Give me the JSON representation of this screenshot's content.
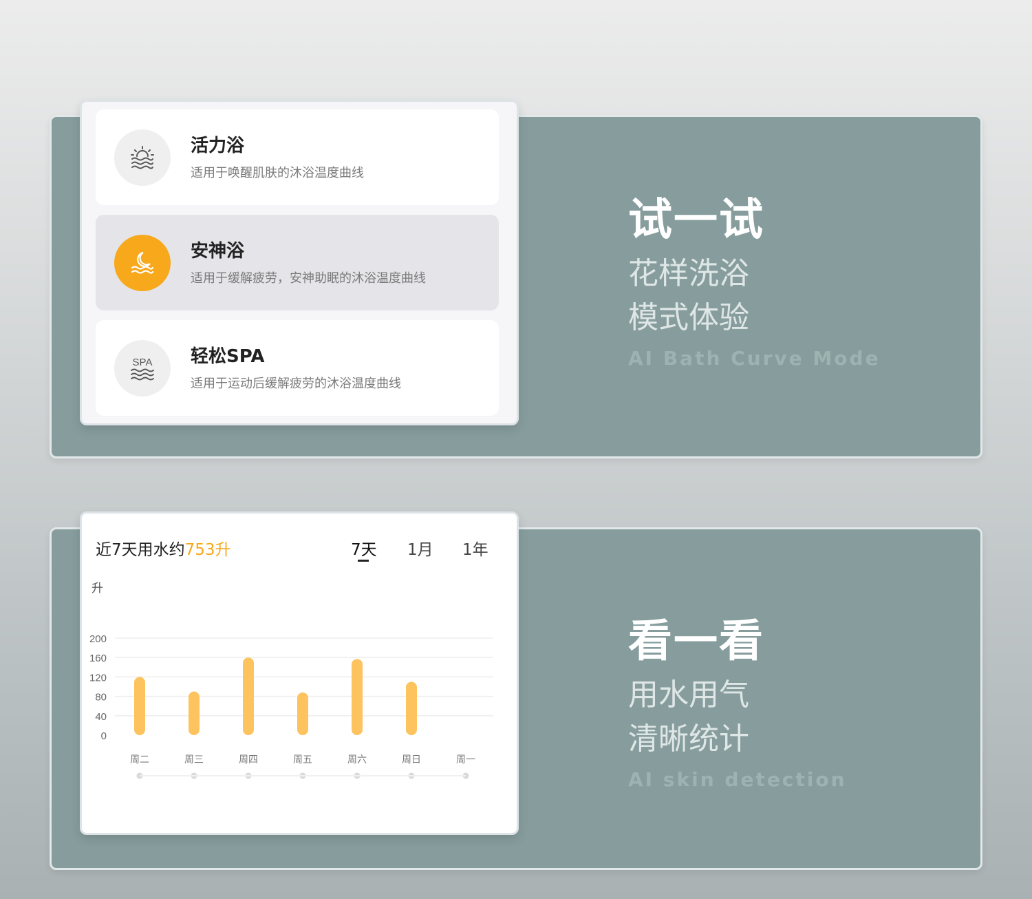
{
  "modes": {
    "items": [
      {
        "title": "活力浴",
        "desc": "适用于唤醒肌肤的沐浴温度曲线",
        "icon": "sunrise-waves-icon",
        "active": false
      },
      {
        "title": "安神浴",
        "desc": "适用于缓解疲劳，安神助眠的沐浴温度曲线",
        "icon": "moon-waves-icon",
        "active": true
      },
      {
        "title": "轻松SPA",
        "desc": "适用于运动后缓解疲劳的沐浴温度曲线",
        "icon": "spa-waves-icon",
        "active": false
      }
    ],
    "spa_icon_text": "SPA"
  },
  "section1": {
    "title": "试一试",
    "sub1": "花样洗浴",
    "sub2": "模式体验",
    "en": "AI Bath Curve Mode"
  },
  "section2": {
    "title": "看一看",
    "sub1": "用水用气",
    "sub2": "清晰统计",
    "en": "AI skin detection"
  },
  "stats": {
    "head_prefix": "近7天用水约",
    "head_value": "753升",
    "tabs": [
      "7天",
      "1月",
      "1年"
    ],
    "active_tab": 0
  },
  "colors": {
    "accent": "#f7a81b",
    "bar": "#fdc35e",
    "panel": "#879d9d"
  },
  "chart_data": {
    "type": "bar",
    "unit_label": "升",
    "categories": [
      "周二",
      "周三",
      "周四",
      "周五",
      "周六",
      "周日",
      "周一"
    ],
    "values": [
      120,
      90,
      160,
      88,
      157,
      110,
      0
    ],
    "y_ticks": [
      0,
      40,
      80,
      120,
      160,
      200
    ],
    "ylim": [
      0,
      200
    ],
    "grid": true
  }
}
